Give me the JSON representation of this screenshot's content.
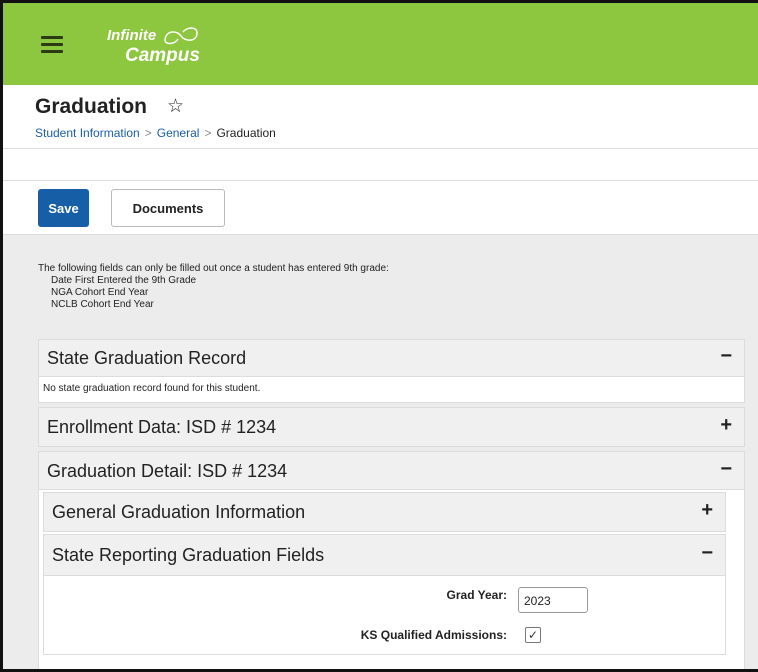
{
  "header": {
    "logo_line1": "Infinite",
    "logo_line2": "Campus"
  },
  "page": {
    "title": "Graduation",
    "breadcrumb": [
      "Student Information",
      "General",
      "Graduation"
    ]
  },
  "toolbar": {
    "save_label": "Save",
    "documents_label": "Documents"
  },
  "notice": {
    "intro": "The following fields can only be filled out once a student has entered 9th grade:",
    "items": [
      "Date First Entered the 9th Grade",
      "NGA Cohort End Year",
      "NCLB Cohort End Year"
    ]
  },
  "panels": {
    "state_record": {
      "title": "State Graduation Record",
      "toggle": "−",
      "message": "No state graduation record found for this student."
    },
    "enrollment": {
      "title": "Enrollment Data: ISD # 1234",
      "toggle": "+"
    },
    "grad_detail": {
      "title": "Graduation Detail: ISD # 1234",
      "toggle": "−"
    },
    "general_info": {
      "title": "General Graduation Information",
      "toggle": "+"
    },
    "state_fields": {
      "title": "State Reporting Graduation Fields",
      "toggle": "−"
    }
  },
  "fields": {
    "grad_year_label": "Grad Year:",
    "grad_year_value": "2023",
    "ks_admissions_label": "KS Qualified Admissions:",
    "ks_admissions_checked": true
  },
  "icons": {
    "menu": "hamburger-menu-icon",
    "favorite": "star-outline-icon",
    "checkbox": "checkmark-icon"
  },
  "colors": {
    "header": "#8dc63f",
    "primary_button": "#165ea6",
    "link": "#1a5fa8"
  }
}
